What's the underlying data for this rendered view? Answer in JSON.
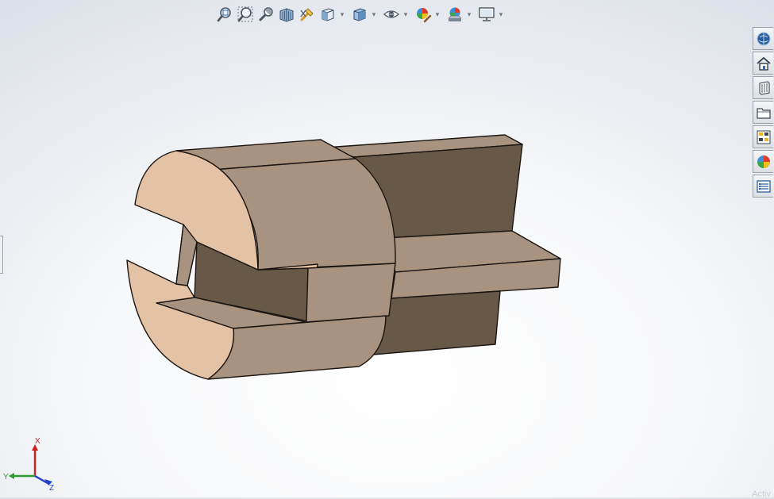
{
  "toolbar": {
    "icons": [
      "zoom-to-fit-icon",
      "zoom-to-area-icon",
      "previous-view-icon",
      "section-view-icon",
      "dynamic-annotation-icon",
      "view-orientation-icon",
      "display-style-icon",
      "hide-show-items-icon",
      "edit-appearance-icon",
      "apply-scene-icon",
      "view-settings-icon"
    ]
  },
  "task_pane": {
    "tabs": [
      "solidworks-resources-icon",
      "design-library-icon",
      "file-explorer-icon",
      "view-palette-icon",
      "appearances-icon",
      "custom-properties-icon"
    ]
  },
  "model": {
    "face_light": "#e3c2a6",
    "face_mid": "#a89280",
    "face_dark": "#675848",
    "edge": "#1b1511"
  },
  "triad": {
    "x_label": "X",
    "y_label": "Y",
    "z_label": "Z",
    "x_color": "#d21e1e",
    "y_color": "#2e9a2e",
    "z_color": "#1f3fc8"
  },
  "watermark": "Activ"
}
